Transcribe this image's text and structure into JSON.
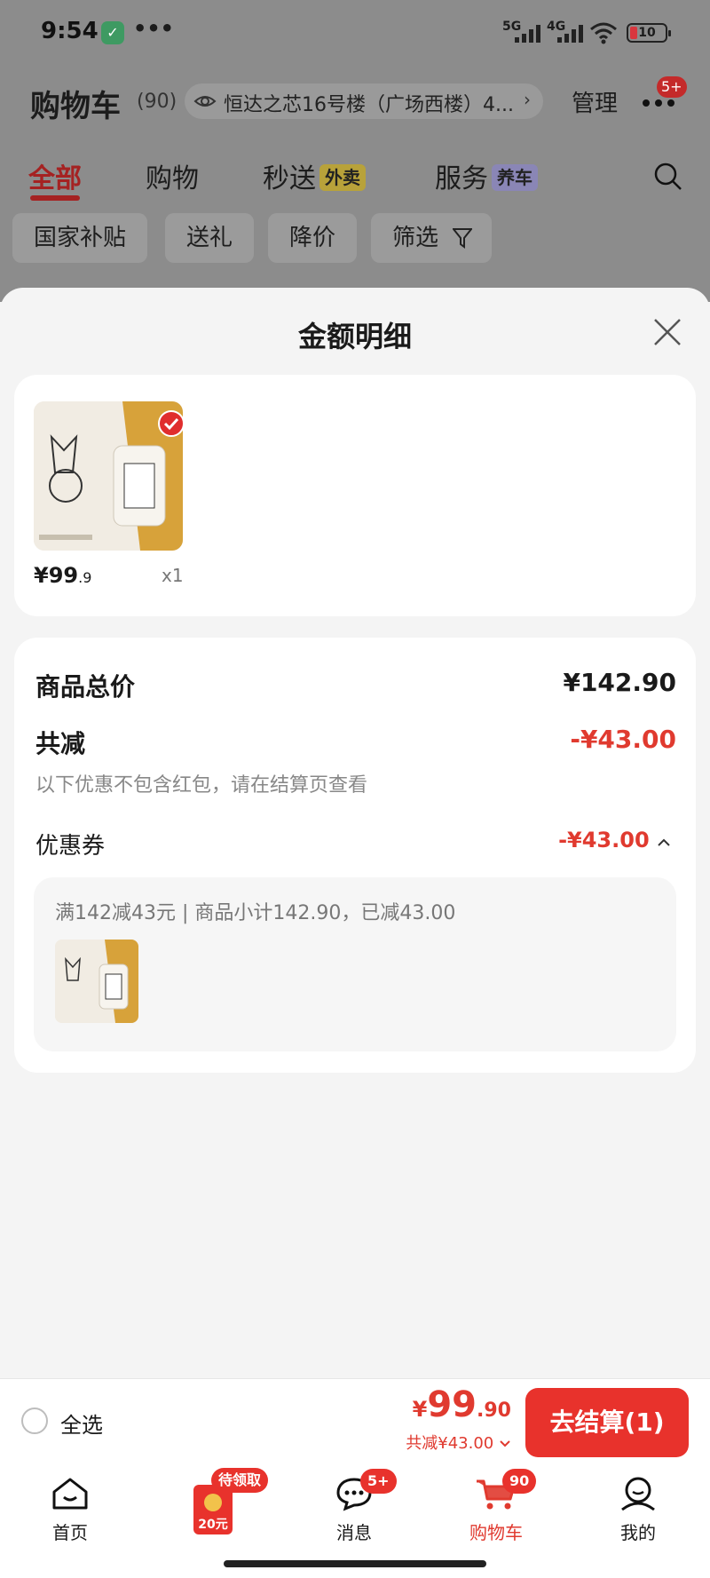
{
  "status_bar": {
    "time": "9:54",
    "app_icon": "✓",
    "more": "•••",
    "net1": "5G",
    "net2": "4G",
    "battery": "10"
  },
  "header": {
    "title": "购物车",
    "count": "(90)",
    "address": "恒达之芯16号楼（广场西楼）4...",
    "manage": "管理",
    "more_badge": "5+"
  },
  "tabs": [
    {
      "label": "全部",
      "tag": ""
    },
    {
      "label": "购物",
      "tag": ""
    },
    {
      "label": "秒送",
      "tag": "外卖"
    },
    {
      "label": "服务",
      "tag": "养车"
    }
  ],
  "chips": [
    "国家补贴",
    "送礼",
    "降价",
    "筛选"
  ],
  "sheet": {
    "title": "金额明细",
    "item": {
      "price_int": "¥99",
      "price_dec": ".9",
      "qty": "x1"
    },
    "total_label": "商品总价",
    "total_value": "¥142.90",
    "discount_label": "共减",
    "discount_value": "-¥43.00",
    "note": "以下优惠不包含红包，请在结算页查看",
    "coupon_label": "优惠券",
    "coupon_value": "-¥43.00",
    "coupon_detail": "满142减43元 | 商品小计142.90，已减43.00"
  },
  "checkout": {
    "select_all": "全选",
    "yen": "¥",
    "price_int": "99",
    "price_dec": ".90",
    "discount": "共减¥43.00",
    "button": "去结算(1)"
  },
  "tabbar": [
    {
      "label": "首页",
      "icon": "home-icon",
      "badge": ""
    },
    {
      "label": "",
      "icon": "red-packet-icon",
      "badge": "待领取",
      "amount": "20元"
    },
    {
      "label": "消息",
      "icon": "message-icon",
      "badge": "5+"
    },
    {
      "label": "购物车",
      "icon": "cart-icon",
      "badge": "90"
    },
    {
      "label": "我的",
      "icon": "user-icon",
      "badge": ""
    }
  ],
  "colors": {
    "accent_red": "#e03a2f",
    "button_red": "#e8322c"
  }
}
